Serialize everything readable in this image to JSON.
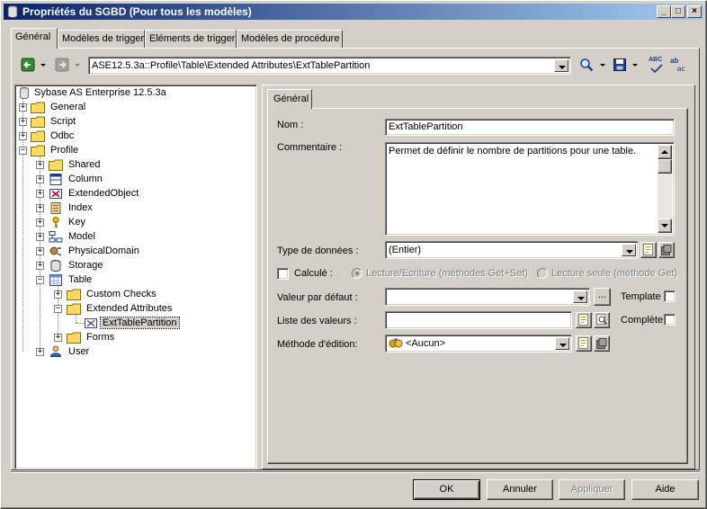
{
  "window": {
    "title": "Propriétés du SGBD (Pour tous les modèles)",
    "minimize": "_",
    "maximize": "□",
    "close": "×"
  },
  "tabs": [
    {
      "label": "Général",
      "active": true
    },
    {
      "label": "Modèles de trigger",
      "active": false
    },
    {
      "label": "Eléments de trigger",
      "active": false
    },
    {
      "label": "Modèles de procédure",
      "active": false
    }
  ],
  "toolbar": {
    "path": "ASE12.5.3a::Profile\\Table\\Extended Attributes\\ExtTablePartition",
    "spell_icon_text": "ABC",
    "abc_icon_text": "ab"
  },
  "tree": {
    "root": "Sybase AS Enterprise 12.5.3a",
    "items": [
      {
        "label": "General"
      },
      {
        "label": "Script"
      },
      {
        "label": "Odbc"
      },
      {
        "label": "Profile"
      },
      {
        "label": "Shared"
      },
      {
        "label": "Column"
      },
      {
        "label": "ExtendedObject"
      },
      {
        "label": "Index"
      },
      {
        "label": "Key"
      },
      {
        "label": "Model"
      },
      {
        "label": "PhysicalDomain"
      },
      {
        "label": "Storage"
      },
      {
        "label": "Table"
      },
      {
        "label": "Custom Checks"
      },
      {
        "label": "Extended Attributes"
      },
      {
        "label": "ExtTablePartition"
      },
      {
        "label": "Forms"
      },
      {
        "label": "User"
      }
    ],
    "selected": "ExtTablePartition"
  },
  "detail": {
    "tab_label": "Général",
    "name_label": "Nom :",
    "name_value": "ExtTablePartition",
    "comment_label": "Commentaire :",
    "comment_value": "Permet de définir le nombre de partitions pour une table.",
    "datatype_label": "Type de données :",
    "datatype_value": "(Entier)",
    "computed_label": "Calculé :",
    "radio_rw_label": "Lecture/Ecriture (méthodes Get+Set)",
    "radio_ro_label": "Lecture seule (méthode Get)",
    "default_label": "Valeur par défaut :",
    "default_value": "",
    "ellipsis": "...",
    "template_label": "Template",
    "list_label": "Liste des valeurs :",
    "list_value": "",
    "complete_label": "Complète",
    "edit_method_label": "Méthode d'édition:",
    "edit_method_value": "<Aucun>"
  },
  "buttons": {
    "ok": "OK",
    "cancel": "Annuler",
    "apply": "Appliquer",
    "help": "Aide"
  },
  "colors": {
    "title_start": "#0a246a",
    "title_end": "#a6caf0",
    "face": "#d4d0c8",
    "folder": "#ffd966"
  }
}
